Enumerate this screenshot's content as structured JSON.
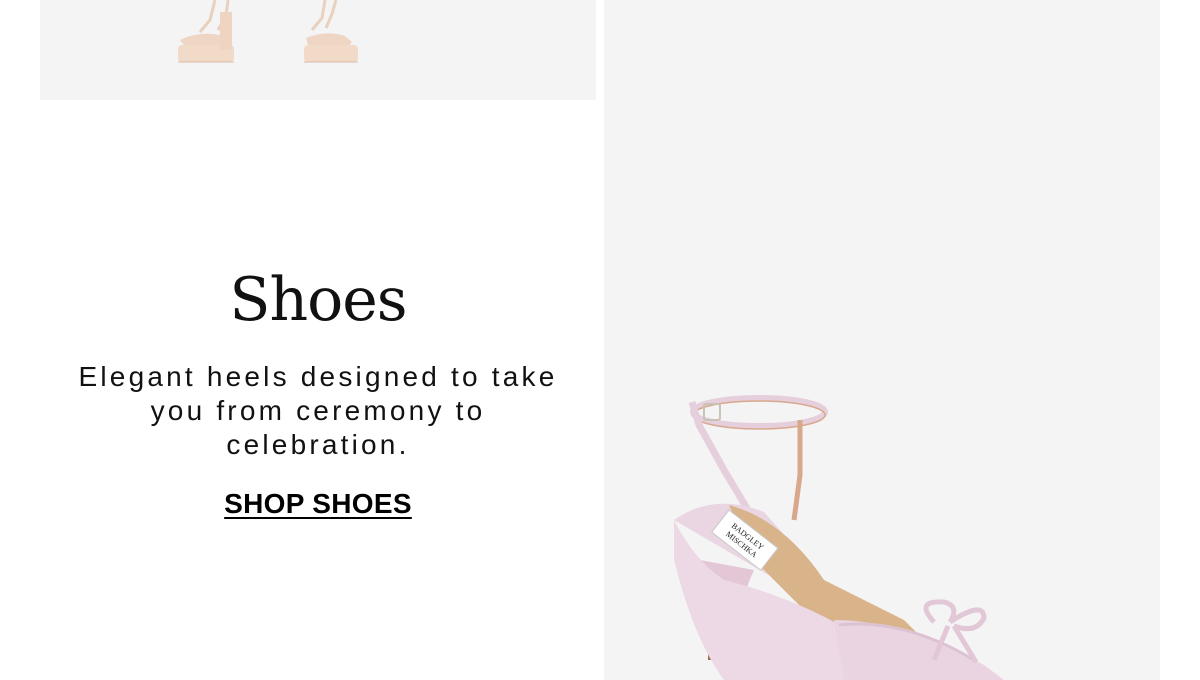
{
  "promo": {
    "title": "Shoes",
    "body": "Elegant heels designed to take you from ceremony to celebration.",
    "cta_label": "SHOP SHOES"
  },
  "images": {
    "top_left": {
      "depicts": "platform-sandals-nude",
      "background": "#f4f4f4"
    },
    "right": {
      "depicts": "pink-satin-slingback-heel-with-bow",
      "background": "#f4f4f4",
      "insole_brand": "BADGLEY MISCHKA"
    }
  },
  "colors": {
    "text": "#111111",
    "cta": "#000000",
    "tile_bg": "#f4f4f4",
    "sandal": "#f0d2bf",
    "heel_pink": "#ecd8e4",
    "insole": "#d9b48a"
  }
}
